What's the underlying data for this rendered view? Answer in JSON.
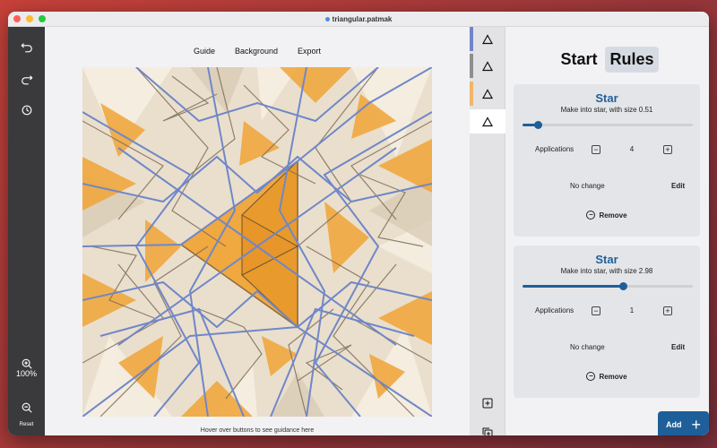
{
  "window": {
    "title": "triangular.patmak"
  },
  "toolbar": {
    "undo_icon": "undo-icon",
    "redo_icon": "redo-icon",
    "history_icon": "history-icon",
    "zoom_in_icon": "zoom-in-icon",
    "zoom_level": "100%",
    "zoom_out_icon": "zoom-out-icon",
    "reset_label": "Reset"
  },
  "menu": {
    "guide": "Guide",
    "background": "Background",
    "export": "Export"
  },
  "guidance_text": "Hover over buttons to see guidance here",
  "shapes": {
    "items": [
      {
        "icon": "triangle-icon",
        "color": "#6f87c9",
        "selected": false
      },
      {
        "icon": "triangle-icon",
        "color": "#8e8e8e",
        "selected": false
      },
      {
        "icon": "triangle-icon",
        "color": "#f0b56a",
        "selected": false
      },
      {
        "icon": "triangle-icon",
        "color": "#ffffff",
        "selected": true
      }
    ],
    "add_icon": "add-shape-icon",
    "duplicate_icon": "duplicate-shape-icon"
  },
  "rules_panel": {
    "tabs": [
      {
        "label": "Start",
        "active": false
      },
      {
        "label": "Rules",
        "active": true
      }
    ],
    "cards": [
      {
        "title": "Star",
        "description": "Make into star, with size 0.51",
        "slider_value": 0.09,
        "applications_label": "Applications",
        "applications": "4",
        "change": "No change",
        "edit": "Edit",
        "remove": "Remove"
      },
      {
        "title": "Star",
        "description": "Make into star, with size 2.98",
        "slider_value": 0.59,
        "applications_label": "Applications",
        "applications": "1",
        "change": "No change",
        "edit": "Edit",
        "remove": "Remove"
      }
    ],
    "add_label": "Add"
  },
  "colors": {
    "accent": "#1f5f99",
    "line_blue": "#6f87c9",
    "orange": "#f0a840",
    "tan": "#eadfcc",
    "toolbar_bg": "#3a3a3c"
  }
}
